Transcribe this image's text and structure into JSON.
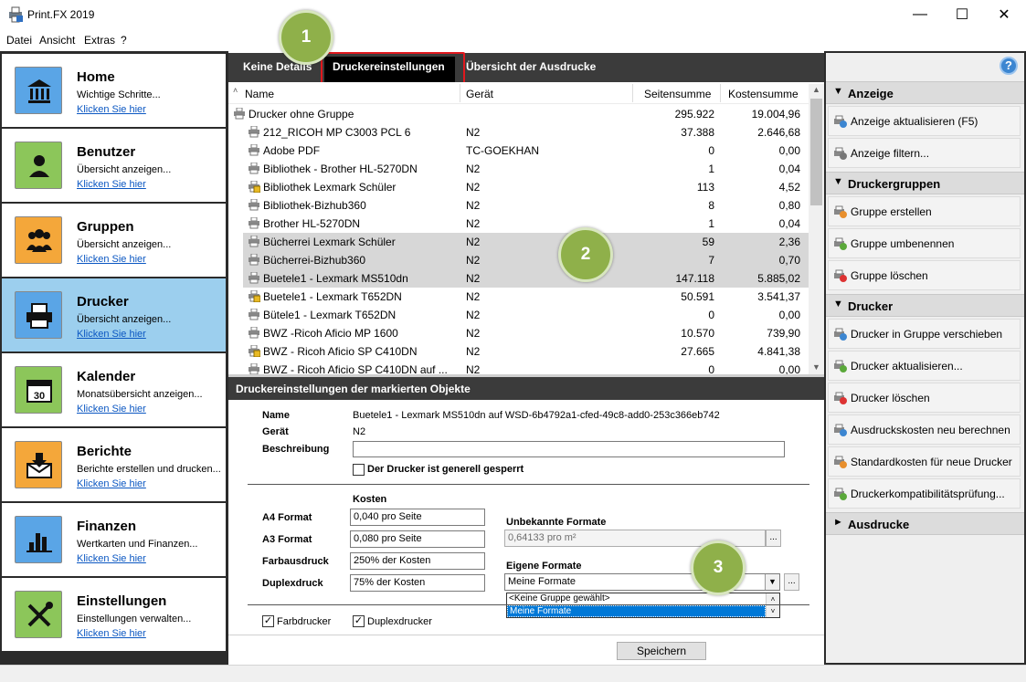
{
  "window": {
    "title": "Print.FX 2019",
    "min": "—",
    "max": "☐",
    "close": "✕"
  },
  "menu": [
    "Datei",
    "Ansicht",
    "Extras",
    "?"
  ],
  "nav": [
    {
      "title": "Home",
      "sub": "Wichtige Schritte...",
      "link": "Klicken Sie hier",
      "icon": "bank-icon",
      "color": "#5aa5e6"
    },
    {
      "title": "Benutzer",
      "sub": "Übersicht anzeigen...",
      "link": "Klicken Sie hier",
      "icon": "user-icon",
      "color": "#8cc65a"
    },
    {
      "title": "Gruppen",
      "sub": "Übersicht anzeigen...",
      "link": "Klicken Sie hier",
      "icon": "users-icon",
      "color": "#f4a73a"
    },
    {
      "title": "Drucker",
      "sub": "Übersicht anzeigen...",
      "link": "Klicken Sie hier",
      "icon": "printer-icon",
      "color": "#5aa5e6"
    },
    {
      "title": "Kalender",
      "sub": "Monatsübersicht anzeigen...",
      "link": "Klicken Sie hier",
      "icon": "calendar-icon",
      "color": "#8cc65a"
    },
    {
      "title": "Berichte",
      "sub": "Berichte erstellen und drucken...",
      "link": "Klicken Sie hier",
      "icon": "mail-icon",
      "color": "#f4a73a"
    },
    {
      "title": "Finanzen",
      "sub": "Wertkarten und Finanzen...",
      "link": "Klicken Sie hier",
      "icon": "bar-chart-icon",
      "color": "#5aa5e6"
    },
    {
      "title": "Einstellungen",
      "sub": "Einstellungen verwalten...",
      "link": "Klicken Sie hier",
      "icon": "tools-icon",
      "color": "#8cc65a"
    }
  ],
  "tabs": [
    "Keine Details",
    "Druckereinstellungen",
    "Übersicht der Ausdrucke"
  ],
  "badges": [
    "1",
    "2",
    "3"
  ],
  "columns": {
    "sort": "˄",
    "name": "Name",
    "device": "Gerät",
    "pages": "Seitensumme",
    "cost": "Kostensumme"
  },
  "rows": [
    {
      "name": "Drucker ohne Gruppe",
      "device": "",
      "pages": "295.922",
      "cost": "19.004,96",
      "group": true,
      "sel": false,
      "lock": false
    },
    {
      "name": "212_RICOH MP C3003 PCL 6",
      "device": "N2",
      "pages": "37.388",
      "cost": "2.646,68",
      "group": false,
      "sel": false,
      "lock": false
    },
    {
      "name": "Adobe PDF",
      "device": "TC-GOEKHAN",
      "pages": "0",
      "cost": "0,00",
      "group": false,
      "sel": false,
      "lock": false
    },
    {
      "name": "Bibliothek - Brother HL-5270DN",
      "device": "N2",
      "pages": "1",
      "cost": "0,04",
      "group": false,
      "sel": false,
      "lock": false
    },
    {
      "name": "Bibliothek Lexmark Schüler",
      "device": "N2",
      "pages": "113",
      "cost": "4,52",
      "group": false,
      "sel": false,
      "lock": true
    },
    {
      "name": "Bibliothek-Bizhub360",
      "device": "N2",
      "pages": "8",
      "cost": "0,80",
      "group": false,
      "sel": false,
      "lock": false
    },
    {
      "name": "Brother HL-5270DN",
      "device": "N2",
      "pages": "1",
      "cost": "0,04",
      "group": false,
      "sel": false,
      "lock": false
    },
    {
      "name": "Bücherrei Lexmark Schüler",
      "device": "N2",
      "pages": "59",
      "cost": "2,36",
      "group": false,
      "sel": true,
      "lock": false
    },
    {
      "name": "Bücherrei-Bizhub360",
      "device": "N2",
      "pages": "7",
      "cost": "0,70",
      "group": false,
      "sel": true,
      "lock": false
    },
    {
      "name": "Buetele1 - Lexmark MS510dn",
      "device": "N2",
      "pages": "147.118",
      "cost": "5.885,02",
      "group": false,
      "sel": true,
      "lock": false
    },
    {
      "name": "Buetele1 - Lexmark T652DN",
      "device": "N2",
      "pages": "50.591",
      "cost": "3.541,37",
      "group": false,
      "sel": false,
      "lock": true
    },
    {
      "name": "Bütele1 - Lexmark T652DN",
      "device": "N2",
      "pages": "0",
      "cost": "0,00",
      "group": false,
      "sel": false,
      "lock": false
    },
    {
      "name": "BWZ  -Ricoh Aficio MP 1600",
      "device": "N2",
      "pages": "10.570",
      "cost": "739,90",
      "group": false,
      "sel": false,
      "lock": false
    },
    {
      "name": "BWZ - Ricoh Aficio SP C410DN",
      "device": "N2",
      "pages": "27.665",
      "cost": "4.841,38",
      "group": false,
      "sel": false,
      "lock": true
    },
    {
      "name": "BWZ - Ricoh Aficio SP C410DN auf ...",
      "device": "N2",
      "pages": "0",
      "cost": "0,00",
      "group": false,
      "sel": false,
      "lock": false
    }
  ],
  "settings": {
    "header": "Druckereinstellungen der markierten Objekte",
    "name_label": "Name",
    "name_value": "Buetele1 - Lexmark MS510dn auf WSD-6b4792a1-cfed-49c8-add0-253c366eb742",
    "device_label": "Gerät",
    "device_value": "N2",
    "desc_label": "Beschreibung",
    "desc_value": "",
    "locked_label": "Der Drucker ist generell gesperrt",
    "costs_label": "Kosten",
    "a4_label": "A4 Format",
    "a4_value": "0,040 pro Seite",
    "a3_label": "A3 Format",
    "a3_value": "0,080 pro Seite",
    "color_label": "Farbausdruck",
    "color_value": "250% der Kosten",
    "duplex_label": "Duplexdruck",
    "duplex_value": "75% der Kosten",
    "unknown_label": "Unbekannte Formate",
    "unknown_value": "0,64133 pro m²",
    "custom_label": "Eigene Formate",
    "custom_value": "Meine Formate",
    "dropdown_options": [
      "<Keine Gruppe gewählt>",
      "Meine Formate"
    ],
    "colorprinter_label": "Farbdrucker",
    "duplexprinter_label": "Duplexdrucker",
    "check_mark": "✓",
    "browse": "...",
    "save": "Speichern"
  },
  "right": {
    "help": "?",
    "sections": [
      {
        "title": "Anzeige",
        "items": [
          "Anzeige aktualisieren (F5)",
          "Anzeige filtern..."
        ]
      },
      {
        "title": "Druckergruppen",
        "items": [
          "Gruppe erstellen",
          "Gruppe umbenennen",
          "Gruppe löschen"
        ]
      },
      {
        "title": "Drucker",
        "items": [
          "Drucker in Gruppe verschieben",
          "Drucker aktualisieren...",
          "Drucker löschen",
          "Ausdruckskosten neu berechnen",
          "Standardkosten für neue Drucker",
          "Druckerkompatibilitätsprüfung..."
        ]
      },
      {
        "title": "Ausdrucke",
        "items": []
      }
    ]
  },
  "colors": {
    "accent": "#9ccfee",
    "badge": "#8fb04a",
    "highlight": "#e0181e",
    "link": "#0b57c2"
  }
}
